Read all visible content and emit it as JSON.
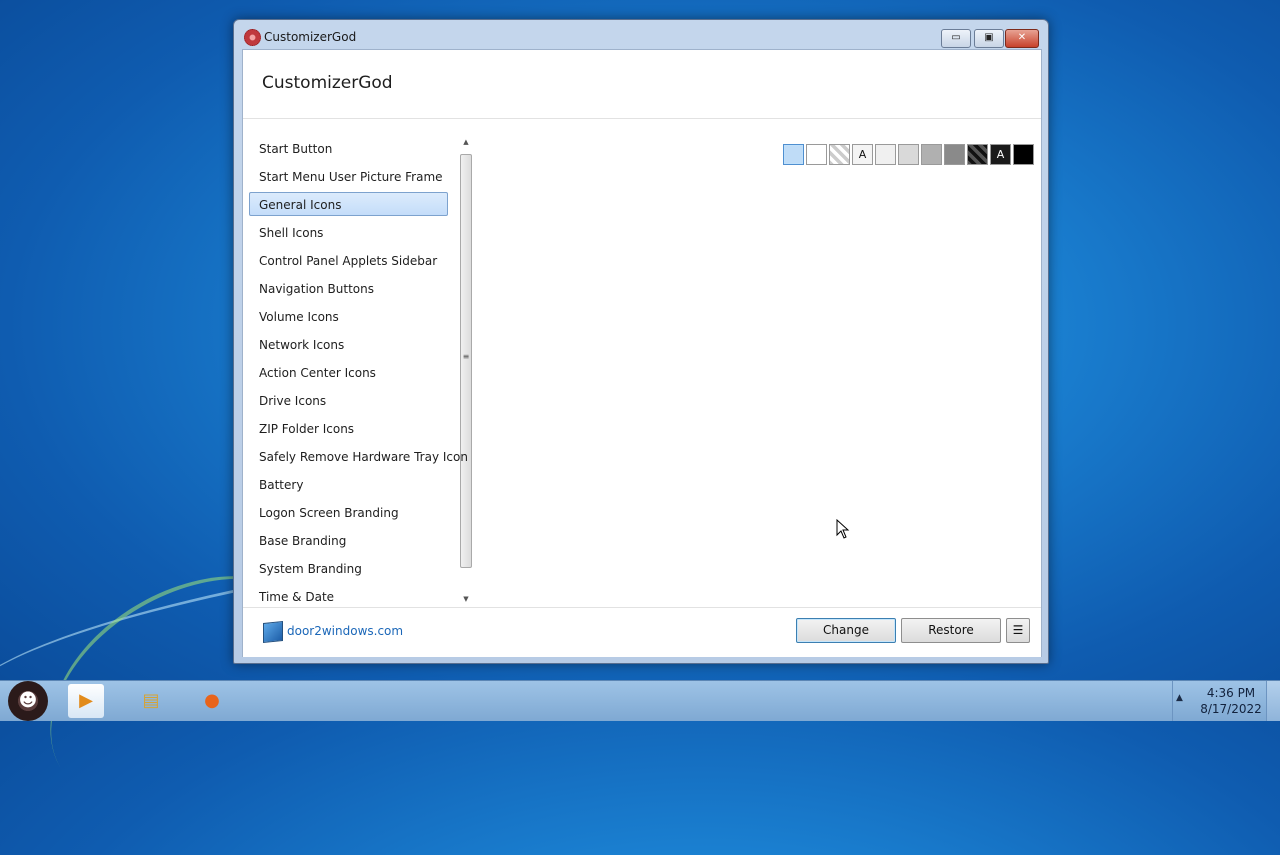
{
  "window": {
    "title": "CustomizerGod",
    "heading": "CustomizerGod",
    "controls": {
      "minimize": "▭",
      "maximize": "▣",
      "close": "✕"
    }
  },
  "sidebar": {
    "selected": "General Icons",
    "items": [
      {
        "label": "Start Button"
      },
      {
        "label": "Start Menu User Picture Frame"
      },
      {
        "label": "General Icons"
      },
      {
        "label": "Shell Icons"
      },
      {
        "label": "Control Panel Applets Sidebar"
      },
      {
        "label": "Navigation Buttons"
      },
      {
        "label": "Volume Icons"
      },
      {
        "label": "Network Icons"
      },
      {
        "label": "Action Center Icons"
      },
      {
        "label": "Drive Icons"
      },
      {
        "label": "ZIP Folder Icons"
      },
      {
        "label": "Safely Remove Hardware Tray Icon"
      },
      {
        "label": "Battery"
      },
      {
        "label": "Logon Screen Branding"
      },
      {
        "label": "Base Branding"
      },
      {
        "label": "System Branding"
      },
      {
        "label": "Time & Date"
      }
    ]
  },
  "swatches": [
    {
      "name": "light-blue",
      "color": "#bfdcf7",
      "glyph": ""
    },
    {
      "name": "white",
      "color": "#ffffff",
      "glyph": ""
    },
    {
      "name": "checker",
      "color": "#e6e6e6",
      "glyph": ""
    },
    {
      "name": "light-text",
      "color": "#f4f4f4",
      "glyph": "A"
    },
    {
      "name": "very-light-gray",
      "color": "#f0f0f0",
      "glyph": ""
    },
    {
      "name": "light-gray",
      "color": "#d9d9d9",
      "glyph": ""
    },
    {
      "name": "mid-gray",
      "color": "#b0b0b0",
      "glyph": ""
    },
    {
      "name": "gray",
      "color": "#8a8a8a",
      "glyph": ""
    },
    {
      "name": "dark-checker",
      "color": "#2a2a2a",
      "glyph": ""
    },
    {
      "name": "dark-text",
      "color": "#1a1a1a",
      "glyph": "A"
    },
    {
      "name": "black",
      "color": "#000000",
      "glyph": ""
    }
  ],
  "footer": {
    "link": "door2windows.com",
    "change_label": "Change",
    "restore_label": "Restore",
    "menu_glyph": "☰"
  },
  "taskbar": {
    "time": "4:36 PM",
    "date": "8/17/2022",
    "tray_arrow": "▲",
    "items": [
      "start-orb",
      "media-player-icon",
      "file-explorer-icon",
      "firefox-icon"
    ]
  }
}
